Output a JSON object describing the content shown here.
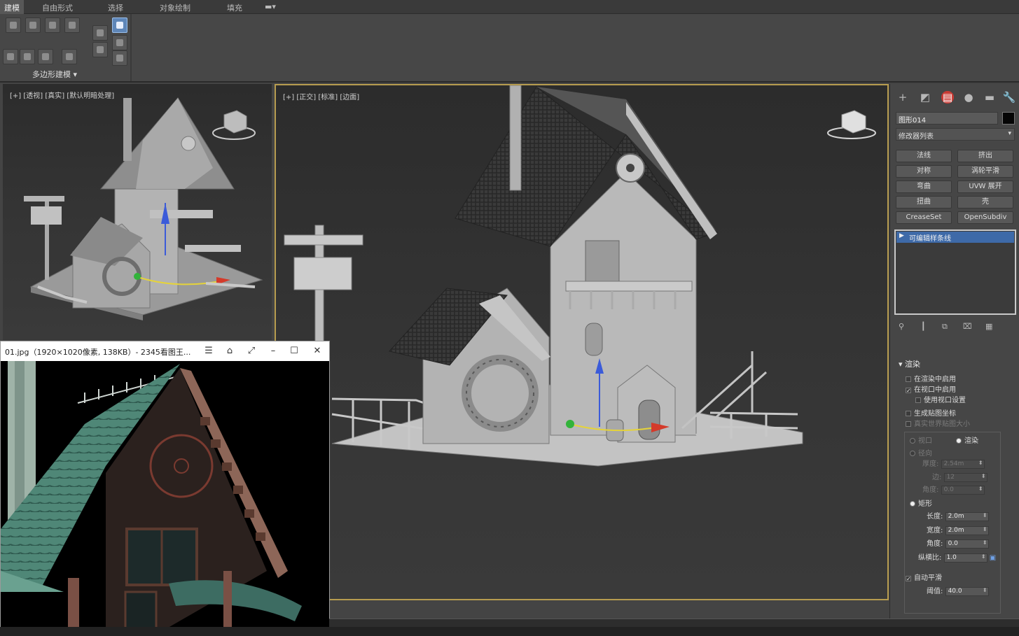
{
  "ribbon": {
    "tabs": [
      "建模",
      "自由形式",
      "选择",
      "对象绘制",
      "填充"
    ],
    "panel_label": "多边形建模 ▾"
  },
  "viewports": {
    "left_label": "[+] [透视] [真实] [默认明暗处理]",
    "main_label": "[+] [正交] [标准] [边面]"
  },
  "command_panel": {
    "tab_icons": [
      "create-icon",
      "modify-icon",
      "hierarchy-icon",
      "motion-icon",
      "display-icon",
      "utilities-icon"
    ],
    "object_name": "图形014",
    "object_color": "#050505",
    "modifier_list": "修改器列表",
    "buttons": [
      "法线",
      "挤出",
      "对称",
      "涡轮平滑",
      "弯曲",
      "UVW 展开",
      "扭曲",
      "壳",
      "CreaseSet",
      "OpenSubdiv"
    ],
    "stack_item": "可编辑样条线",
    "rollout_title": "渲染",
    "checks": [
      {
        "label": "在渲染中启用",
        "checked": false
      },
      {
        "label": "在视口中启用",
        "checked": true
      },
      {
        "label": "使用视口设置",
        "checked": false
      },
      {
        "label": "生成贴图坐标",
        "checked": false
      },
      {
        "label": "真实世界贴图大小",
        "checked": false
      }
    ],
    "radio_viewport": "视口",
    "radio_render": "渲染",
    "radial": "径向",
    "radial_fields": [
      {
        "label": "厚度:",
        "value": "2.54m"
      },
      {
        "label": "边:",
        "value": "12"
      },
      {
        "label": "角度:",
        "value": "0.0"
      }
    ],
    "rectangular": "矩形",
    "rect_fields": [
      {
        "label": "长度:",
        "value": "2.0m"
      },
      {
        "label": "宽度:",
        "value": "2.0m"
      },
      {
        "label": "角度:",
        "value": "0.0"
      },
      {
        "label": "纵横比:",
        "value": "1.0"
      }
    ],
    "auto_smooth": "自动平滑",
    "threshold_label": "阈值:",
    "threshold_value": "40.0"
  },
  "image_viewer": {
    "title": "01.jpg（1920×1020像素, 138KB）- 2345看图王..."
  }
}
